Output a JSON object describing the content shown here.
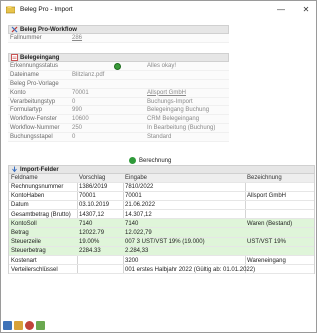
{
  "window": {
    "title": "Beleg Pro - Import",
    "minimize": "—",
    "close": "✕"
  },
  "workflow": {
    "header": "Beleg Pro-Workflow",
    "rows": [
      {
        "label": "Fallnummer",
        "value": "286"
      }
    ]
  },
  "belegeingang": {
    "header": "Belegeingang",
    "rows": [
      {
        "label": "Erkennungsstatus",
        "value": "",
        "value2": "Alles okay!"
      },
      {
        "label": "Dateiname",
        "value": "Blitzlanz.pdf",
        "value2": ""
      },
      {
        "label": "Beleg Pro-Vorlage",
        "value": "",
        "value2": ""
      },
      {
        "label": "Konto",
        "value": "70001",
        "value2": "Allsport GmbH"
      },
      {
        "label": "Verarbeitungstyp",
        "value": "0",
        "value2": "Buchungs-Import"
      },
      {
        "label": "Formulartyp",
        "value": "990",
        "value2": "Belegeingang Buchung"
      },
      {
        "label": "Workflow-Fenster",
        "value": "10600",
        "value2": "CRM Belegeingang"
      },
      {
        "label": "Workflow-Nummer",
        "value": "250",
        "value2": "In Bearbeitung (Buchung)"
      },
      {
        "label": "Buchungsstapel",
        "value": "0",
        "value2": "Standard"
      }
    ]
  },
  "calc_label": "Berechnung",
  "import": {
    "header": "Import-Felder",
    "columns": [
      "Feldname",
      "Vorschlag",
      "Eingabe",
      "Bezeichnung"
    ],
    "rows": [
      {
        "f": "Rechnungsnummer",
        "v": "1386/2019",
        "e": "7810/2022",
        "b": "",
        "green": false
      },
      {
        "f": "KontoHaben",
        "v": "70001",
        "e": "70001",
        "b": "Allsport GmbH",
        "green": false
      },
      {
        "f": "Datum",
        "v": "03.10.2019",
        "e": "21.06.2022",
        "b": "",
        "green": false
      },
      {
        "f": "Gesamtbetrag (Brutto)",
        "v": "14307,12",
        "e": "14.307,12",
        "b": "",
        "green": false
      },
      {
        "f": "KontoSoll",
        "v": "7140",
        "e": "7140",
        "b": "Waren (Bestand)",
        "green": true
      },
      {
        "f": "Betrag",
        "v": "12022.79",
        "e": "12.022,79",
        "b": "",
        "green": true
      },
      {
        "f": "Steuerzeile",
        "v": "19.00%",
        "e": "007 3   UST/VST 19% (19.000)",
        "b": "UST/VST 19%",
        "green": true
      },
      {
        "f": "Steuerbetrag",
        "v": "2284.33",
        "e": "2.284,33",
        "b": "",
        "green": true
      },
      {
        "f": "Kostenart",
        "v": "",
        "e": "3200",
        "b": "Wareneingang",
        "green": false
      },
      {
        "f": "Verteilerschlüssel",
        "v": "",
        "e": "001  erstes Halbjahr 2022 (Gültig ab: 01.01.2022)",
        "b": "",
        "green": false
      }
    ]
  },
  "colors": {
    "green_row": "#dff5d9",
    "section_header": "#e6e6e6",
    "link": "#8a8a8a"
  }
}
